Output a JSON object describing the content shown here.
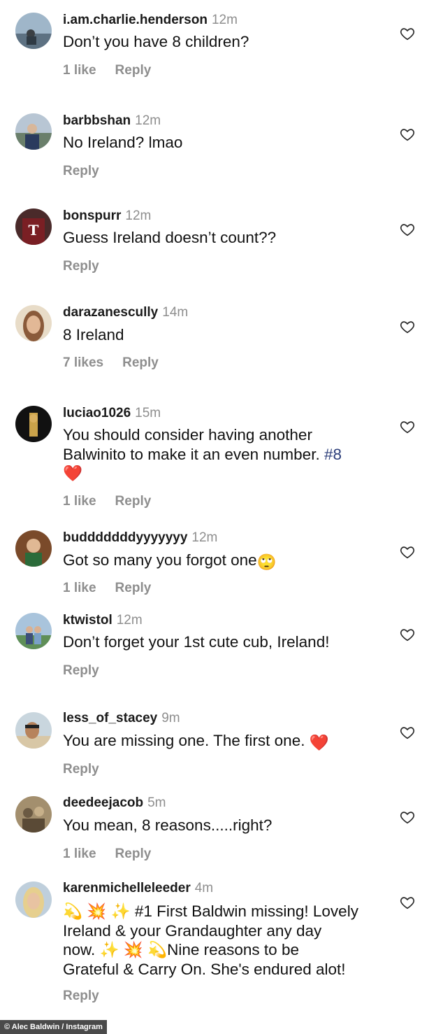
{
  "comments": [
    {
      "username": "i.am.charlie.henderson",
      "time": "12m",
      "text": "Don’t you have 8 children?",
      "likes": "1 like",
      "reply": "Reply",
      "avatar_icon": "profile-photo-icon"
    },
    {
      "username": "barbbshan",
      "time": "12m",
      "text": "No Ireland? lmao",
      "likes": "",
      "reply": "Reply",
      "avatar_icon": "profile-photo-icon"
    },
    {
      "username": "bonspurr",
      "time": "12m",
      "text": "Guess Ireland doesn’t count??",
      "likes": "",
      "reply": "Reply",
      "avatar_icon": "profile-photo-icon"
    },
    {
      "username": "darazanescully",
      "time": "14m",
      "text": "8 Ireland",
      "likes": "7 likes",
      "reply": "Reply",
      "avatar_icon": "profile-photo-icon"
    },
    {
      "username": "luciao1026",
      "time": "15m",
      "text_line1": "You should consider having another",
      "text_line2": "Balwinito to make it an even number. ",
      "hashtag": "#8",
      "emoji": "❤️",
      "likes": "1 like",
      "reply": "Reply",
      "avatar_icon": "profile-photo-icon"
    },
    {
      "username": "budddddddyyyyyyy",
      "time": "12m",
      "text": "Got so many you forgot one",
      "emoji": "🙄",
      "likes": "1 like",
      "reply": "Reply",
      "avatar_icon": "profile-photo-icon"
    },
    {
      "username": "ktwistol",
      "time": "12m",
      "text": "Don’t forget your 1st cute cub, Ireland!",
      "likes": "",
      "reply": "Reply",
      "avatar_icon": "profile-photo-icon"
    },
    {
      "username": "less_of_stacey",
      "time": "9m",
      "text": "You are missing one. The first one. ",
      "emoji": "❤️",
      "likes": "",
      "reply": "Reply",
      "avatar_icon": "profile-photo-icon"
    },
    {
      "username": "deedeejacob",
      "time": "5m",
      "text": "You mean, 8 reasons.....right?",
      "likes": "1 like",
      "reply": "Reply",
      "avatar_icon": "profile-photo-icon"
    },
    {
      "username": "karenmichelleleeder",
      "time": "4m",
      "emoji_lead": "💫 💥 ✨",
      "text_line1": "#1 First Baldwin missing! Lovely",
      "text_line2": "Ireland & your Grandaughter any day",
      "text_line3_pre": "now. ",
      "emoji_mid": "✨ 💥 💫",
      "text_line3_post": "Nine reasons to be",
      "text_line4": "Grateful & Carry On. She's endured alot!",
      "likes": "",
      "reply": "Reply",
      "avatar_icon": "profile-photo-icon"
    }
  ],
  "like_icon": "heart-outline-icon",
  "credit": "© Alec Baldwin / Instagram"
}
